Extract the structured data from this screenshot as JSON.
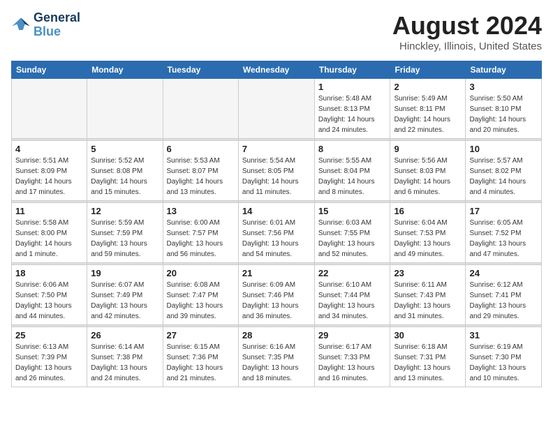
{
  "header": {
    "logo_line1": "General",
    "logo_line2": "Blue",
    "month": "August 2024",
    "location": "Hinckley, Illinois, United States"
  },
  "weekdays": [
    "Sunday",
    "Monday",
    "Tuesday",
    "Wednesday",
    "Thursday",
    "Friday",
    "Saturday"
  ],
  "weeks": [
    [
      {
        "day": "",
        "empty": true
      },
      {
        "day": "",
        "empty": true
      },
      {
        "day": "",
        "empty": true
      },
      {
        "day": "",
        "empty": true
      },
      {
        "day": "1",
        "sunrise": "5:48 AM",
        "sunset": "8:13 PM",
        "daylight": "14 hours and 24 minutes."
      },
      {
        "day": "2",
        "sunrise": "5:49 AM",
        "sunset": "8:11 PM",
        "daylight": "14 hours and 22 minutes."
      },
      {
        "day": "3",
        "sunrise": "5:50 AM",
        "sunset": "8:10 PM",
        "daylight": "14 hours and 20 minutes."
      }
    ],
    [
      {
        "day": "4",
        "sunrise": "5:51 AM",
        "sunset": "8:09 PM",
        "daylight": "14 hours and 17 minutes."
      },
      {
        "day": "5",
        "sunrise": "5:52 AM",
        "sunset": "8:08 PM",
        "daylight": "14 hours and 15 minutes."
      },
      {
        "day": "6",
        "sunrise": "5:53 AM",
        "sunset": "8:07 PM",
        "daylight": "14 hours and 13 minutes."
      },
      {
        "day": "7",
        "sunrise": "5:54 AM",
        "sunset": "8:05 PM",
        "daylight": "14 hours and 11 minutes."
      },
      {
        "day": "8",
        "sunrise": "5:55 AM",
        "sunset": "8:04 PM",
        "daylight": "14 hours and 8 minutes."
      },
      {
        "day": "9",
        "sunrise": "5:56 AM",
        "sunset": "8:03 PM",
        "daylight": "14 hours and 6 minutes."
      },
      {
        "day": "10",
        "sunrise": "5:57 AM",
        "sunset": "8:02 PM",
        "daylight": "14 hours and 4 minutes."
      }
    ],
    [
      {
        "day": "11",
        "sunrise": "5:58 AM",
        "sunset": "8:00 PM",
        "daylight": "14 hours and 1 minute."
      },
      {
        "day": "12",
        "sunrise": "5:59 AM",
        "sunset": "7:59 PM",
        "daylight": "13 hours and 59 minutes."
      },
      {
        "day": "13",
        "sunrise": "6:00 AM",
        "sunset": "7:57 PM",
        "daylight": "13 hours and 56 minutes."
      },
      {
        "day": "14",
        "sunrise": "6:01 AM",
        "sunset": "7:56 PM",
        "daylight": "13 hours and 54 minutes."
      },
      {
        "day": "15",
        "sunrise": "6:03 AM",
        "sunset": "7:55 PM",
        "daylight": "13 hours and 52 minutes."
      },
      {
        "day": "16",
        "sunrise": "6:04 AM",
        "sunset": "7:53 PM",
        "daylight": "13 hours and 49 minutes."
      },
      {
        "day": "17",
        "sunrise": "6:05 AM",
        "sunset": "7:52 PM",
        "daylight": "13 hours and 47 minutes."
      }
    ],
    [
      {
        "day": "18",
        "sunrise": "6:06 AM",
        "sunset": "7:50 PM",
        "daylight": "13 hours and 44 minutes."
      },
      {
        "day": "19",
        "sunrise": "6:07 AM",
        "sunset": "7:49 PM",
        "daylight": "13 hours and 42 minutes."
      },
      {
        "day": "20",
        "sunrise": "6:08 AM",
        "sunset": "7:47 PM",
        "daylight": "13 hours and 39 minutes."
      },
      {
        "day": "21",
        "sunrise": "6:09 AM",
        "sunset": "7:46 PM",
        "daylight": "13 hours and 36 minutes."
      },
      {
        "day": "22",
        "sunrise": "6:10 AM",
        "sunset": "7:44 PM",
        "daylight": "13 hours and 34 minutes."
      },
      {
        "day": "23",
        "sunrise": "6:11 AM",
        "sunset": "7:43 PM",
        "daylight": "13 hours and 31 minutes."
      },
      {
        "day": "24",
        "sunrise": "6:12 AM",
        "sunset": "7:41 PM",
        "daylight": "13 hours and 29 minutes."
      }
    ],
    [
      {
        "day": "25",
        "sunrise": "6:13 AM",
        "sunset": "7:39 PM",
        "daylight": "13 hours and 26 minutes."
      },
      {
        "day": "26",
        "sunrise": "6:14 AM",
        "sunset": "7:38 PM",
        "daylight": "13 hours and 24 minutes."
      },
      {
        "day": "27",
        "sunrise": "6:15 AM",
        "sunset": "7:36 PM",
        "daylight": "13 hours and 21 minutes."
      },
      {
        "day": "28",
        "sunrise": "6:16 AM",
        "sunset": "7:35 PM",
        "daylight": "13 hours and 18 minutes."
      },
      {
        "day": "29",
        "sunrise": "6:17 AM",
        "sunset": "7:33 PM",
        "daylight": "13 hours and 16 minutes."
      },
      {
        "day": "30",
        "sunrise": "6:18 AM",
        "sunset": "7:31 PM",
        "daylight": "13 hours and 13 minutes."
      },
      {
        "day": "31",
        "sunrise": "6:19 AM",
        "sunset": "7:30 PM",
        "daylight": "13 hours and 10 minutes."
      }
    ]
  ]
}
